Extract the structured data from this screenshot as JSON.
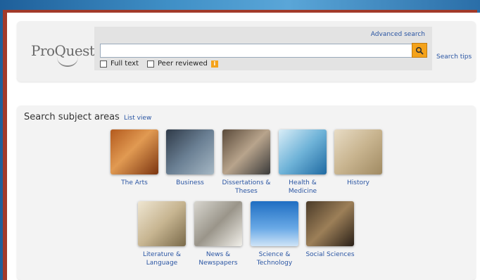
{
  "logo": {
    "text": "ProQuest"
  },
  "search": {
    "advanced_label": "Advanced search",
    "input_value": "",
    "options": [
      {
        "label": "Full text"
      },
      {
        "label": "Peer reviewed"
      }
    ],
    "tips_label": "Search tips"
  },
  "subjects": {
    "title": "Search subject areas",
    "list_view_label": "List view",
    "row1": [
      {
        "label": "The Arts"
      },
      {
        "label": "Business"
      },
      {
        "label": "Dissertations &\nTheses"
      },
      {
        "label": "Health &\nMedicine"
      },
      {
        "label": "History"
      }
    ],
    "row2": [
      {
        "label": "Literature &\nLanguage"
      },
      {
        "label": "News &\nNewspapers"
      },
      {
        "label": "Science &\nTechnology"
      },
      {
        "label": "Social Sciences"
      }
    ]
  },
  "colors": {
    "accent": "#f4a21a",
    "link": "#2a55a3",
    "frame": "#a23a2a"
  }
}
